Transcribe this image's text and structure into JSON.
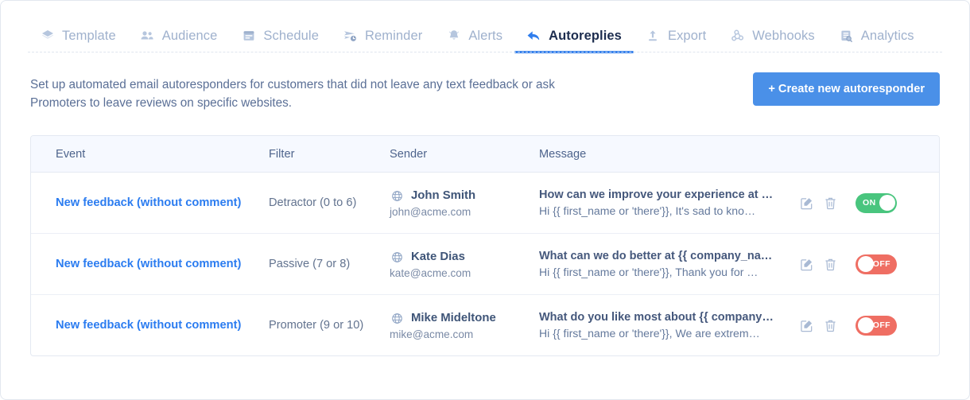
{
  "tabs": [
    {
      "label": "Template",
      "icon": "layers-icon",
      "active": false
    },
    {
      "label": "Audience",
      "icon": "people-icon",
      "active": false
    },
    {
      "label": "Schedule",
      "icon": "calendar-icon",
      "active": false
    },
    {
      "label": "Reminder",
      "icon": "send-clock-icon",
      "active": false
    },
    {
      "label": "Alerts",
      "icon": "bell-icon",
      "active": false
    },
    {
      "label": "Autoreplies",
      "icon": "reply-arrow-icon",
      "active": true
    },
    {
      "label": "Export",
      "icon": "upload-icon",
      "active": false
    },
    {
      "label": "Webhooks",
      "icon": "webhook-icon",
      "active": false
    },
    {
      "label": "Analytics",
      "icon": "report-icon",
      "active": false
    }
  ],
  "intro": {
    "description": "Set up automated email autoresponders for customers that did not leave any text feedback or ask Promoters to leave reviews on specific websites.",
    "create_button": "+ Create new autoresponder"
  },
  "table": {
    "columns": [
      "Event",
      "Filter",
      "Sender",
      "Message"
    ],
    "rows": [
      {
        "event": "New feedback (without comment)",
        "filter": "Detractor (0 to 6)",
        "sender_name": "John Smith",
        "sender_email": "john@acme.com",
        "msg_subject": "How can we improve your experience at …",
        "msg_body": "Hi {{ first_name or 'there'}}, It's sad to kno…",
        "toggle_state": "ON"
      },
      {
        "event": "New feedback (without comment)",
        "filter": "Passive (7 or 8)",
        "sender_name": "Kate Dias",
        "sender_email": "kate@acme.com",
        "msg_subject": "What can we do better at {{ company_na…",
        "msg_body": "Hi {{ first_name or 'there'}}, Thank you for …",
        "toggle_state": "OFF"
      },
      {
        "event": "New feedback (without comment)",
        "filter": "Promoter (9 or 10)",
        "sender_name": "Mike Mideltone",
        "sender_email": "mike@acme.com",
        "msg_subject": "What do you like most about {{ company…",
        "msg_body": "Hi {{ first_name or 'there'}}, We are extrem…",
        "toggle_state": "OFF"
      }
    ]
  },
  "colors": {
    "accent_blue": "#2f7ded",
    "button_blue": "#4a90e8",
    "toggle_on_green": "#49c57e",
    "toggle_off_red": "#ef6e63",
    "tab_inactive": "#9fb1cd",
    "link_blue": "#2b7cf0"
  }
}
